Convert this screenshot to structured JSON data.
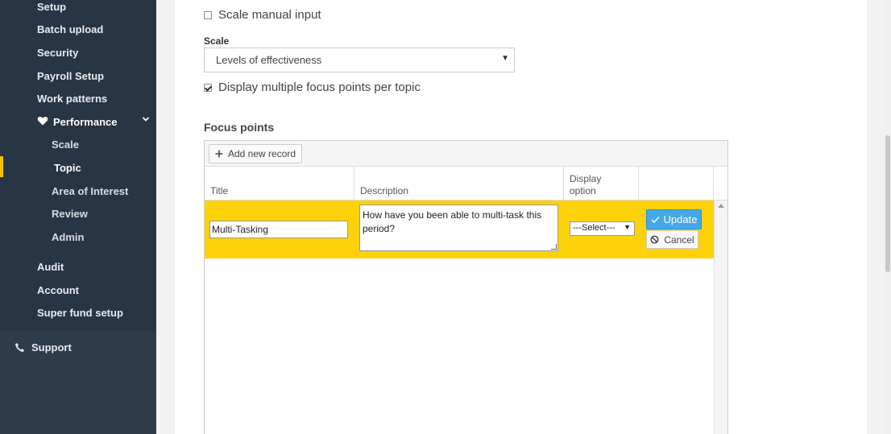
{
  "sidebar": {
    "items": [
      {
        "label": "Setup"
      },
      {
        "label": "Batch upload"
      },
      {
        "label": "Security"
      },
      {
        "label": "Payroll Setup"
      },
      {
        "label": "Work patterns"
      }
    ],
    "performance": {
      "label": "Performance",
      "icon": "heart-icon",
      "subitems": [
        {
          "label": "Scale"
        },
        {
          "label": "Topic",
          "active": true
        },
        {
          "label": "Area of Interest"
        },
        {
          "label": "Review"
        },
        {
          "label": "Admin"
        }
      ]
    },
    "items_after": [
      {
        "label": "Audit"
      },
      {
        "label": "Account"
      },
      {
        "label": "Super fund setup"
      }
    ],
    "support": {
      "label": "Support",
      "icon": "phone-icon"
    },
    "accent_color": "#f5c400"
  },
  "form": {
    "scale_manual_input": {
      "label": "Scale manual input",
      "checked": false
    },
    "scale": {
      "label": "Scale",
      "value": "Levels of effectiveness"
    },
    "multiple_focus": {
      "label": "Display multiple focus points per topic",
      "checked": true
    }
  },
  "focus_points": {
    "title": "Focus points",
    "add_label": "Add new record",
    "columns": [
      "Title",
      "Description",
      "Display option"
    ],
    "edit_row": {
      "title": "Multi-Tasking",
      "description": "How have you been able to multi-task this period?",
      "display_option": "---Select---",
      "update_label": "Update",
      "cancel_label": "Cancel",
      "row_color": "#fdd20b"
    }
  }
}
